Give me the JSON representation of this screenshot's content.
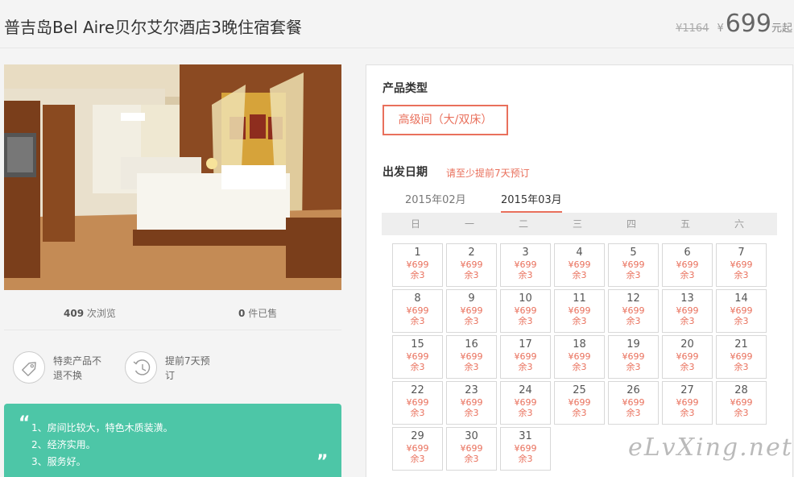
{
  "header": {
    "title": "普吉岛Bel Aire贝尔艾尔酒店3晚住宿套餐",
    "original_price": "¥1164",
    "currency": "¥",
    "price": "699",
    "price_unit": "元起"
  },
  "stats": {
    "views_count": "409",
    "views_label": "次浏览",
    "sold_count": "0",
    "sold_label": "件已售"
  },
  "features": [
    {
      "icon": "tag-icon",
      "text": "特卖产品不退不换"
    },
    {
      "icon": "clock-icon",
      "text": "提前7天预订"
    }
  ],
  "quote": {
    "open_mark": "“",
    "close_mark": "”",
    "lines": [
      "1、房间比较大，特色木质装潢。",
      "2、经济实用。",
      "3、服务好。"
    ]
  },
  "booking": {
    "product_type_label": "产品类型",
    "room_type": "高级间（大/双床）",
    "departure_label": "出发日期",
    "notice": "请至少提前7天预订",
    "months": [
      {
        "label": "2015年02月",
        "active": false
      },
      {
        "label": "2015年03月",
        "active": true
      }
    ],
    "weekdays": [
      "日",
      "一",
      "二",
      "三",
      "四",
      "五",
      "六"
    ],
    "day_price": "¥699",
    "day_stock": "余3",
    "days": [
      "1",
      "2",
      "3",
      "4",
      "5",
      "6",
      "7",
      "8",
      "9",
      "10",
      "11",
      "12",
      "13",
      "14",
      "15",
      "16",
      "17",
      "18",
      "19",
      "20",
      "21",
      "22",
      "23",
      "24",
      "25",
      "26",
      "27",
      "28",
      "29",
      "30",
      "31"
    ]
  },
  "watermark": "eLvXing.net",
  "colors": {
    "accent": "#e9705c",
    "quote_bg": "#4dc6a7"
  }
}
